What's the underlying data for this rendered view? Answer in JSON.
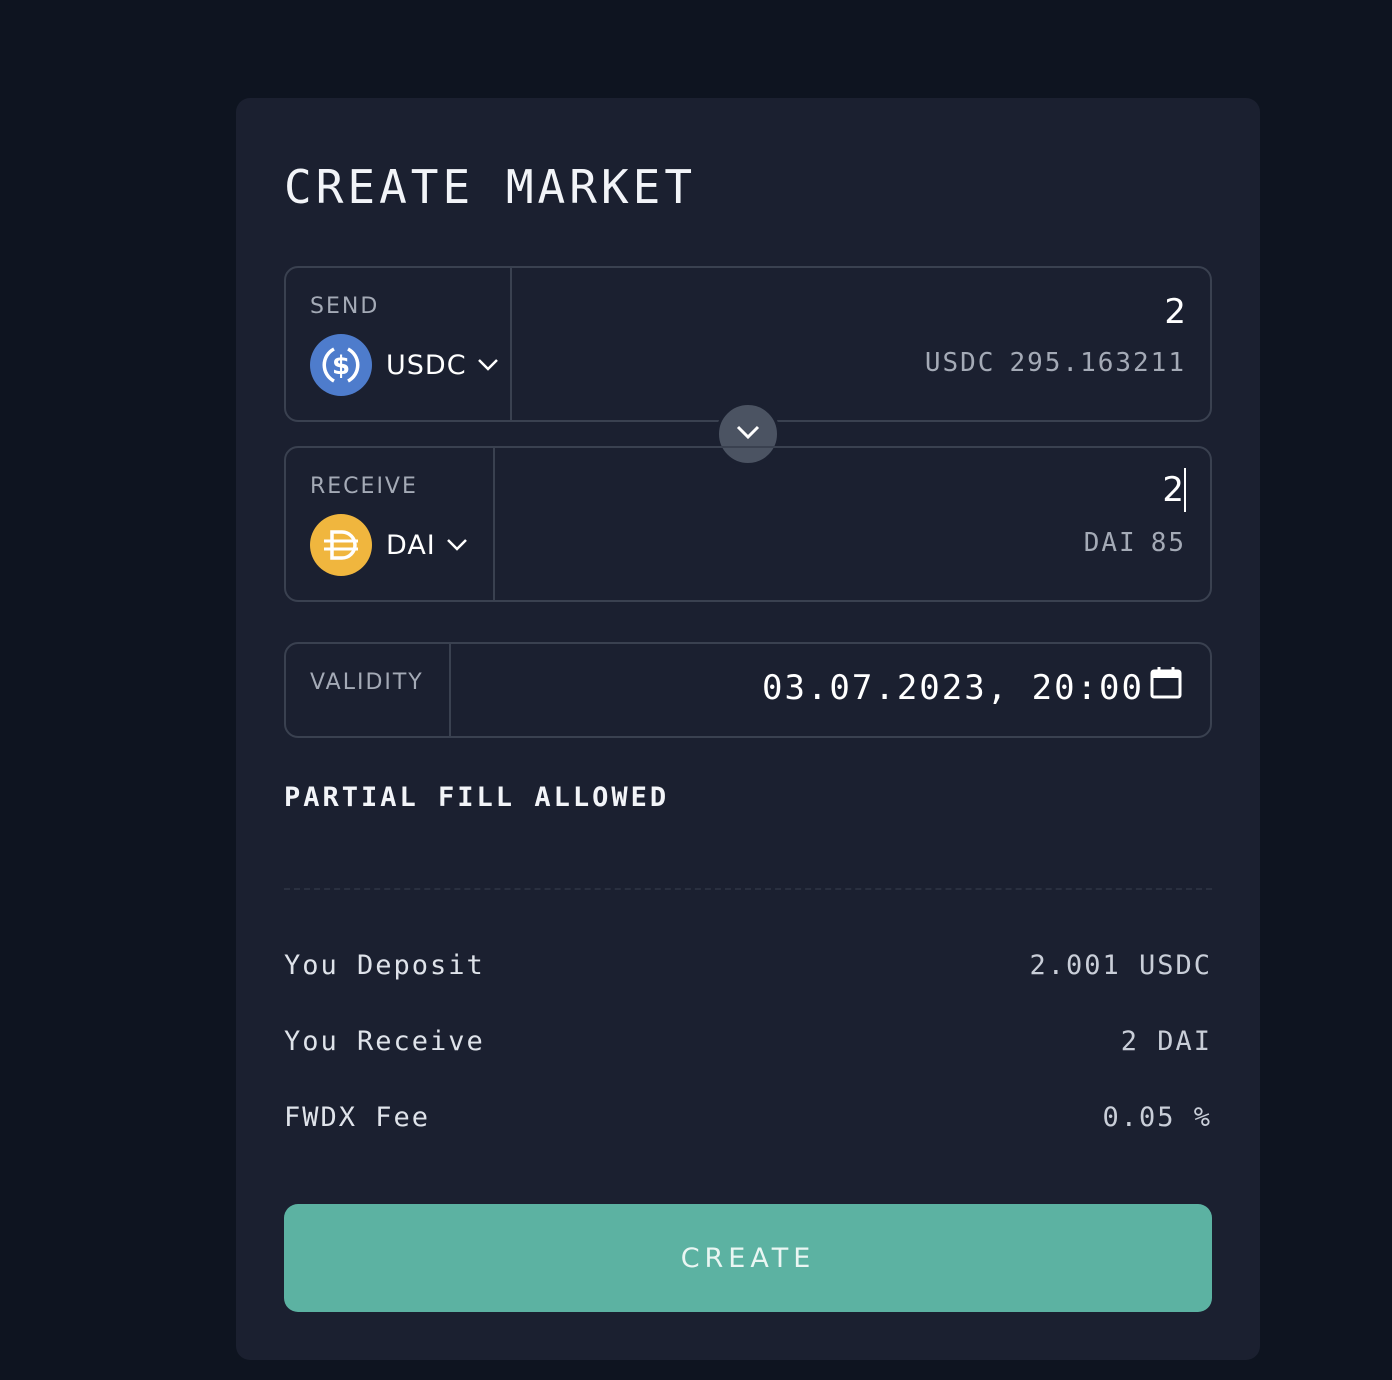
{
  "title": "CREATE MARKET",
  "send": {
    "label": "SEND",
    "token": "USDC",
    "token_icon": "usdc-coin-icon",
    "amount": "2",
    "balance_token": "USDC",
    "balance_value": "295.163211"
  },
  "receive": {
    "label": "RECEIVE",
    "token": "DAI",
    "token_icon": "dai-coin-icon",
    "amount": "2",
    "balance_token": "DAI",
    "balance_value": "85"
  },
  "validity": {
    "label": "VALIDITY",
    "value": "03.07.2023, 20:00"
  },
  "partial_fill": "PARTIAL FILL ALLOWED",
  "summary": [
    {
      "label": "You Deposit",
      "value": "2.001 USDC"
    },
    {
      "label": "You Receive",
      "value": "2 DAI"
    },
    {
      "label": "FWDX Fee",
      "value": "0.05 %"
    }
  ],
  "create_label": "CREATE",
  "colors": {
    "background": "#0e1420",
    "card": "#1b2030",
    "accent": "#5cb2a2",
    "usdc": "#4e7ccc",
    "dai": "#f0b63e"
  }
}
